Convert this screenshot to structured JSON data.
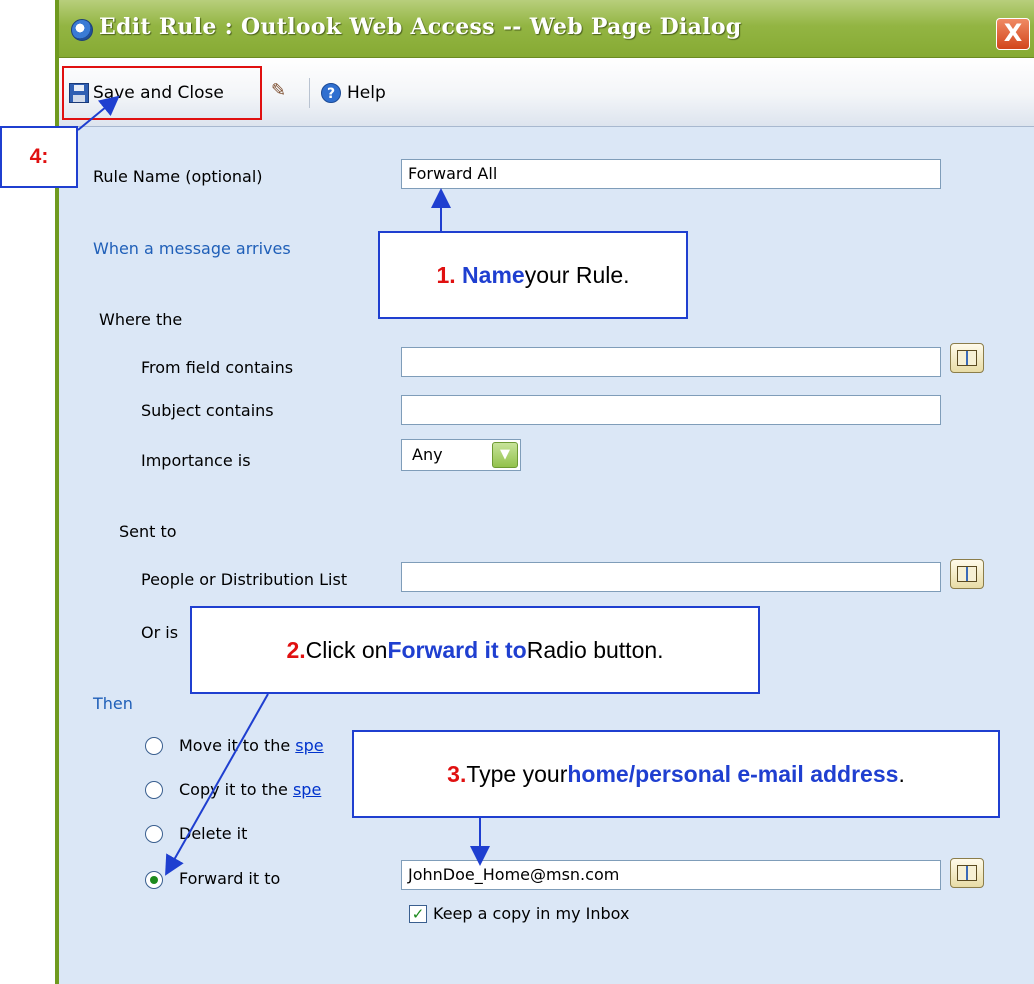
{
  "window": {
    "title": "Edit Rule : Outlook Web Access -- Web Page Dialog",
    "close_label": "X"
  },
  "toolbar": {
    "save_close_label": "Save and Close",
    "help_label": "Help"
  },
  "form": {
    "rule_name_label": "Rule Name  (optional)",
    "rule_name_value": "Forward All",
    "when_section": "When a message arrives",
    "where_the": "Where the",
    "from_field_label": "From field contains",
    "subject_label": "Subject contains",
    "importance_label": "Importance is",
    "importance_value": "Any",
    "sent_to": "Sent to",
    "people_label": "People or Distribution List",
    "or_is_label": "Or is",
    "then_section": "Then",
    "move_label": "Move it to the ",
    "copy_label": "Copy it to the ",
    "move_link_fragment": "spe",
    "copy_link_fragment": "spe",
    "delete_label": "Delete it",
    "forward_label": "Forward it to",
    "forward_value": "JohnDoe_Home@msn.com",
    "keep_copy_label": "Keep a copy in my Inbox"
  },
  "callouts": {
    "c1": {
      "num": "1.",
      "emph": "Name",
      "rest": " your Rule."
    },
    "c2": {
      "num": "2.",
      "pre": " Click on ",
      "emph": "Forward it to",
      "rest": " Radio button."
    },
    "c3": {
      "num": "3.",
      "pre": " Type your ",
      "emph": "home/personal e-mail address",
      "rest": "."
    },
    "c4": {
      "num": "4:"
    }
  },
  "colors": {
    "titlebar": "#93b543",
    "annotation_blue": "#1f3fd0",
    "annotation_red": "#e01010",
    "section_text": "#1f5fb8"
  }
}
